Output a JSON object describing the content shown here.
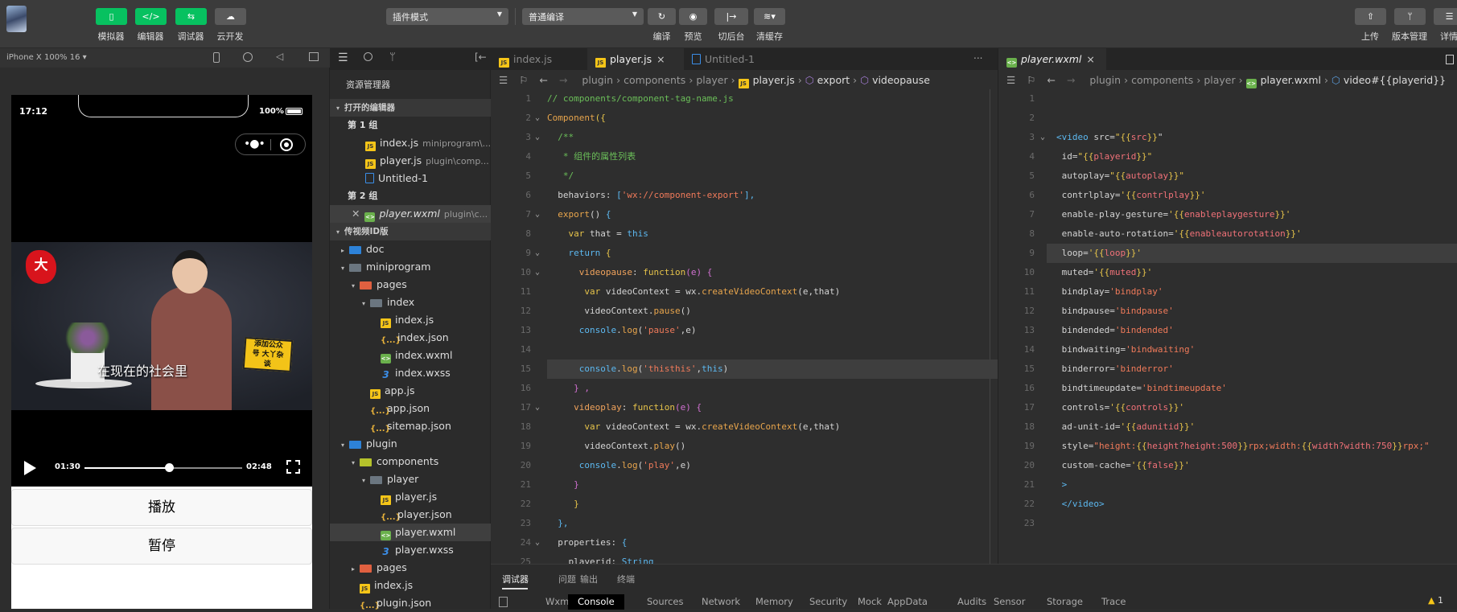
{
  "colors": {
    "accent_green": "#07c160",
    "toolbar_bg": "#3b3b3b",
    "editor_bg": "#2e2e2e",
    "warning": "#f5c518"
  },
  "toolbar": {
    "left_buttons": [
      {
        "label": "模拟器",
        "icon": "phone-icon"
      },
      {
        "label": "编辑器",
        "icon": "code-icon"
      },
      {
        "label": "调试器",
        "icon": "debug-icon"
      },
      {
        "label": "云开发",
        "icon": "cloud-icon"
      }
    ],
    "mode_select": "插件模式",
    "compile_select": "普通编译",
    "action_buttons": [
      {
        "label": "编译",
        "icon": "refresh-icon"
      },
      {
        "label": "预览",
        "icon": "eye-icon"
      },
      {
        "label": "切后台",
        "icon": "switch-background-icon"
      },
      {
        "label": "清缓存",
        "icon": "layers-icon"
      }
    ],
    "right_buttons": [
      {
        "label": "上传",
        "icon": "upload-icon"
      },
      {
        "label": "版本管理",
        "icon": "branch-icon"
      },
      {
        "label": "详情",
        "icon": "menu-icon"
      }
    ]
  },
  "simulator": {
    "device": "iPhone X 100% 16 ▾",
    "status": {
      "time": "17:12",
      "battery": "100%"
    },
    "video": {
      "subtitle": "在现在的社会里",
      "logo_text": "大丫杂谈",
      "badge_text": "添加公众号 大丫杂谈",
      "current_time": "01:30",
      "duration": "02:48",
      "progress": 0.536
    },
    "buttons": [
      "播放",
      "暂停"
    ]
  },
  "explorer": {
    "title": "资源管理器",
    "open_editors_header": "打开的编辑器",
    "project_header": "传视频ID版",
    "rows": [
      {
        "type": "header",
        "label": "打开的编辑器",
        "level": 0
      },
      {
        "type": "group",
        "label": "第 1 组",
        "level": 0
      },
      {
        "type": "file",
        "icon": "js",
        "label": "index.js",
        "desc": "miniprogram\\...",
        "level": 1
      },
      {
        "type": "file",
        "icon": "js",
        "label": "player.js",
        "desc": "plugin\\comp...",
        "level": 1
      },
      {
        "type": "file",
        "icon": "doc",
        "label": "Untitled-1",
        "level": 1
      },
      {
        "type": "group",
        "label": "第 2 组",
        "level": 0
      },
      {
        "type": "file",
        "icon": "wxml",
        "label": "player.wxml",
        "desc": "plugin\\c...",
        "level": 1,
        "italic": true,
        "close": true,
        "selected": true
      },
      {
        "type": "header",
        "label": "传视频ID版",
        "level": 0
      },
      {
        "type": "folder",
        "icon": "folder-blue",
        "label": "doc",
        "level": 0,
        "arrow": "▸"
      },
      {
        "type": "folder",
        "icon": "folder",
        "label": "miniprogram",
        "level": 0,
        "arrow": "▾"
      },
      {
        "type": "folder",
        "icon": "folder-red",
        "label": "pages",
        "level": 1,
        "arrow": "▾"
      },
      {
        "type": "folder",
        "icon": "folder",
        "label": "index",
        "level": 2,
        "arrow": "▾"
      },
      {
        "type": "file",
        "icon": "js",
        "label": "index.js",
        "level": 3
      },
      {
        "type": "file",
        "icon": "json",
        "label": "index.json",
        "level": 3
      },
      {
        "type": "file",
        "icon": "wxml",
        "label": "index.wxml",
        "level": 3
      },
      {
        "type": "file",
        "icon": "wxss",
        "label": "index.wxss",
        "level": 3
      },
      {
        "type": "file",
        "icon": "js",
        "label": "app.js",
        "level": 2
      },
      {
        "type": "file",
        "icon": "json",
        "label": "app.json",
        "level": 2
      },
      {
        "type": "file",
        "icon": "json",
        "label": "sitemap.json",
        "level": 2
      },
      {
        "type": "folder",
        "icon": "folder-blue",
        "label": "plugin",
        "level": 0,
        "arrow": "▾"
      },
      {
        "type": "folder",
        "icon": "folder-green",
        "label": "components",
        "level": 1,
        "arrow": "▾"
      },
      {
        "type": "folder",
        "icon": "folder",
        "label": "player",
        "level": 2,
        "arrow": "▾"
      },
      {
        "type": "file",
        "icon": "js",
        "label": "player.js",
        "level": 3
      },
      {
        "type": "file",
        "icon": "json",
        "label": "player.json",
        "level": 3
      },
      {
        "type": "file",
        "icon": "wxml",
        "label": "player.wxml",
        "level": 3,
        "selected": true
      },
      {
        "type": "file",
        "icon": "wxss",
        "label": "player.wxss",
        "level": 3
      },
      {
        "type": "folder",
        "icon": "folder-red",
        "label": "pages",
        "level": 1,
        "arrow": "▸"
      },
      {
        "type": "file",
        "icon": "js",
        "label": "index.js",
        "level": 1
      },
      {
        "type": "file",
        "icon": "json",
        "label": "plugin.json",
        "level": 1
      }
    ]
  },
  "editor_left": {
    "tabs": [
      {
        "label": "index.js",
        "icon": "js"
      },
      {
        "label": "player.js",
        "icon": "js",
        "active": true,
        "close": "×"
      },
      {
        "label": "Untitled-1",
        "icon": "doc"
      }
    ],
    "more": "...",
    "breadcrumb": [
      "plugin",
      "components",
      "player",
      "player.js",
      "export",
      "videopause"
    ],
    "highlight_line": 15,
    "folds": [
      2,
      3,
      7,
      9,
      10,
      17,
      24
    ],
    "lines": [
      [
        [
          "// components/component-tag-name.js",
          "cm"
        ]
      ],
      [
        [
          "Component",
          "fn"
        ],
        [
          "({",
          "b1"
        ]
      ],
      [
        [
          "  /**",
          "cm"
        ]
      ],
      [
        [
          "   * 组件的属性列表",
          "cm"
        ]
      ],
      [
        [
          "   */",
          "cm"
        ]
      ],
      [
        [
          "  behaviors: ",
          "id"
        ],
        [
          "[",
          "b3"
        ],
        [
          "'wx://component-export'",
          "str"
        ],
        [
          "],",
          "b3"
        ]
      ],
      [
        [
          "  export",
          "fn"
        ],
        [
          "() ",
          "id"
        ],
        [
          "{",
          "b3"
        ]
      ],
      [
        [
          "    var ",
          "kw"
        ],
        [
          "that = ",
          "id"
        ],
        [
          "this",
          "this"
        ]
      ],
      [
        [
          "    return ",
          "this"
        ],
        [
          "{",
          "b1"
        ]
      ],
      [
        [
          "      videopause",
          "prop"
        ],
        [
          ": ",
          "id"
        ],
        [
          "function",
          "kw"
        ],
        [
          "(e) ",
          "b2"
        ],
        [
          "{",
          "b2"
        ]
      ],
      [
        [
          "       var ",
          "kw"
        ],
        [
          "videoContext = wx.",
          "id"
        ],
        [
          "createVideoContext",
          "fn"
        ],
        [
          "(e,that)",
          "id"
        ]
      ],
      [
        [
          "       videoContext.",
          "id"
        ],
        [
          "pause",
          "fn"
        ],
        [
          "()",
          "id"
        ]
      ],
      [
        [
          "      console",
          "this"
        ],
        [
          ".",
          "id"
        ],
        [
          "log",
          "log"
        ],
        [
          "(",
          "id"
        ],
        [
          "'pause'",
          "str"
        ],
        [
          ",e)",
          "id"
        ]
      ],
      [
        [
          "",
          ""
        ]
      ],
      [
        [
          "      console",
          "this"
        ],
        [
          ".",
          "id"
        ],
        [
          "log",
          "log"
        ],
        [
          "(",
          "id"
        ],
        [
          "'thisthis'",
          "str"
        ],
        [
          ",",
          "id"
        ],
        [
          "this",
          "this"
        ],
        [
          ")",
          "id"
        ]
      ],
      [
        [
          "     } ,",
          "b2"
        ]
      ],
      [
        [
          "     videoplay",
          "prop"
        ],
        [
          ": ",
          "id"
        ],
        [
          "function",
          "kw"
        ],
        [
          "(e) ",
          "b2"
        ],
        [
          "{",
          "b2"
        ]
      ],
      [
        [
          "       var ",
          "kw"
        ],
        [
          "videoContext = wx.",
          "id"
        ],
        [
          "createVideoContext",
          "fn"
        ],
        [
          "(e,that)",
          "id"
        ]
      ],
      [
        [
          "       videoContext.",
          "id"
        ],
        [
          "play",
          "fn"
        ],
        [
          "()",
          "id"
        ]
      ],
      [
        [
          "      console",
          "this"
        ],
        [
          ".",
          "id"
        ],
        [
          "log",
          "log"
        ],
        [
          "(",
          "id"
        ],
        [
          "'play'",
          "str"
        ],
        [
          ",e)",
          "id"
        ]
      ],
      [
        [
          "     }",
          "b2"
        ]
      ],
      [
        [
          "     }",
          "b1"
        ]
      ],
      [
        [
          "  },",
          "b3"
        ]
      ],
      [
        [
          "  properties: ",
          "id"
        ],
        [
          "{",
          "b3"
        ]
      ],
      [
        [
          "    playerid: ",
          "id"
        ],
        [
          "String",
          "type"
        ]
      ]
    ]
  },
  "editor_right": {
    "tabs": [
      {
        "label": "player.wxml",
        "icon": "wxml",
        "active": true,
        "close": "×"
      }
    ],
    "breadcrumb": [
      "plugin",
      "components",
      "player",
      "player.wxml",
      "video#{{playerid}}"
    ],
    "highlight_line": 9,
    "folds": [
      3
    ],
    "lines": [
      [
        [
          "",
          ""
        ]
      ],
      [
        [
          "",
          ""
        ]
      ],
      [
        [
          "<video ",
          "tag"
        ],
        [
          "src=",
          "id"
        ],
        [
          "\"",
          "b1"
        ],
        [
          "{{",
          "b1"
        ],
        [
          "src",
          "var"
        ],
        [
          "}}",
          "b1"
        ],
        [
          "\"",
          "id"
        ]
      ],
      [
        [
          " id=",
          "id"
        ],
        [
          "\"{{",
          "b1"
        ],
        [
          "playerid",
          "var"
        ],
        [
          "}}\"",
          "b1"
        ]
      ],
      [
        [
          " autoplay=",
          "id"
        ],
        [
          "\"{{",
          "b1"
        ],
        [
          "autoplay",
          "var"
        ],
        [
          "}}\"",
          "b1"
        ]
      ],
      [
        [
          " contrlplay=",
          "id"
        ],
        [
          "'{{",
          "b1"
        ],
        [
          "contrlplay",
          "var"
        ],
        [
          "}}'",
          "b1"
        ]
      ],
      [
        [
          " enable-play-gesture=",
          "id"
        ],
        [
          "'{{",
          "b1"
        ],
        [
          "enableplaygesture",
          "var"
        ],
        [
          "}}'",
          "b1"
        ]
      ],
      [
        [
          " enable-auto-rotation=",
          "id"
        ],
        [
          "'{{",
          "b1"
        ],
        [
          "enableautorotation",
          "var"
        ],
        [
          "}}'",
          "b1"
        ]
      ],
      [
        [
          " loop=",
          "id"
        ],
        [
          "'{{",
          "b1"
        ],
        [
          "loop",
          "var"
        ],
        [
          "}}'",
          "b1"
        ]
      ],
      [
        [
          " muted=",
          "id"
        ],
        [
          "'{{",
          "b1"
        ],
        [
          "muted",
          "var"
        ],
        [
          "}}'",
          "b1"
        ]
      ],
      [
        [
          " bindplay=",
          "id"
        ],
        [
          "'bindplay'",
          "str"
        ]
      ],
      [
        [
          " bindpause=",
          "id"
        ],
        [
          "'bindpause'",
          "str"
        ]
      ],
      [
        [
          " bindended=",
          "id"
        ],
        [
          "'bindended'",
          "str"
        ]
      ],
      [
        [
          " bindwaiting=",
          "id"
        ],
        [
          "'bindwaiting'",
          "str"
        ]
      ],
      [
        [
          " binderror=",
          "id"
        ],
        [
          "'binderror'",
          "str"
        ]
      ],
      [
        [
          " bindtimeupdate=",
          "id"
        ],
        [
          "'bindtimeupdate'",
          "str"
        ]
      ],
      [
        [
          " controls=",
          "id"
        ],
        [
          "'{{",
          "b1"
        ],
        [
          "controls",
          "var"
        ],
        [
          "}}'",
          "b1"
        ]
      ],
      [
        [
          " ad-unit-id=",
          "id"
        ],
        [
          "'{{",
          "b1"
        ],
        [
          "adunitid",
          "var"
        ],
        [
          "}}'",
          "b1"
        ]
      ],
      [
        [
          " style=",
          "id"
        ],
        [
          "\"height:",
          "str"
        ],
        [
          "{{",
          "b1"
        ],
        [
          "height?height:500",
          "var"
        ],
        [
          "}}",
          "b1"
        ],
        [
          "rpx;width:",
          "str"
        ],
        [
          "{{",
          "b1"
        ],
        [
          "width?width:750",
          "var"
        ],
        [
          "}}",
          "b1"
        ],
        [
          "rpx;\"",
          "str"
        ]
      ],
      [
        [
          " custom-cache=",
          "id"
        ],
        [
          "'{{",
          "b1"
        ],
        [
          "false",
          "var"
        ],
        [
          "}}'",
          "b1"
        ]
      ],
      [
        [
          " >",
          "tag"
        ]
      ],
      [
        [
          " </video>",
          "tag"
        ]
      ],
      [
        [
          "",
          ""
        ]
      ]
    ]
  },
  "bottom_panel": {
    "tabs": [
      "调试器",
      "问题",
      "输出",
      "终端"
    ],
    "devtools_tabs": [
      "Wxml",
      "Console",
      "Sources",
      "Network",
      "Memory",
      "Security",
      "Mock",
      "AppData",
      "Audits",
      "Sensor",
      "Storage",
      "Trace"
    ],
    "active_devtools_tab": "Console",
    "warning_count": "1"
  }
}
